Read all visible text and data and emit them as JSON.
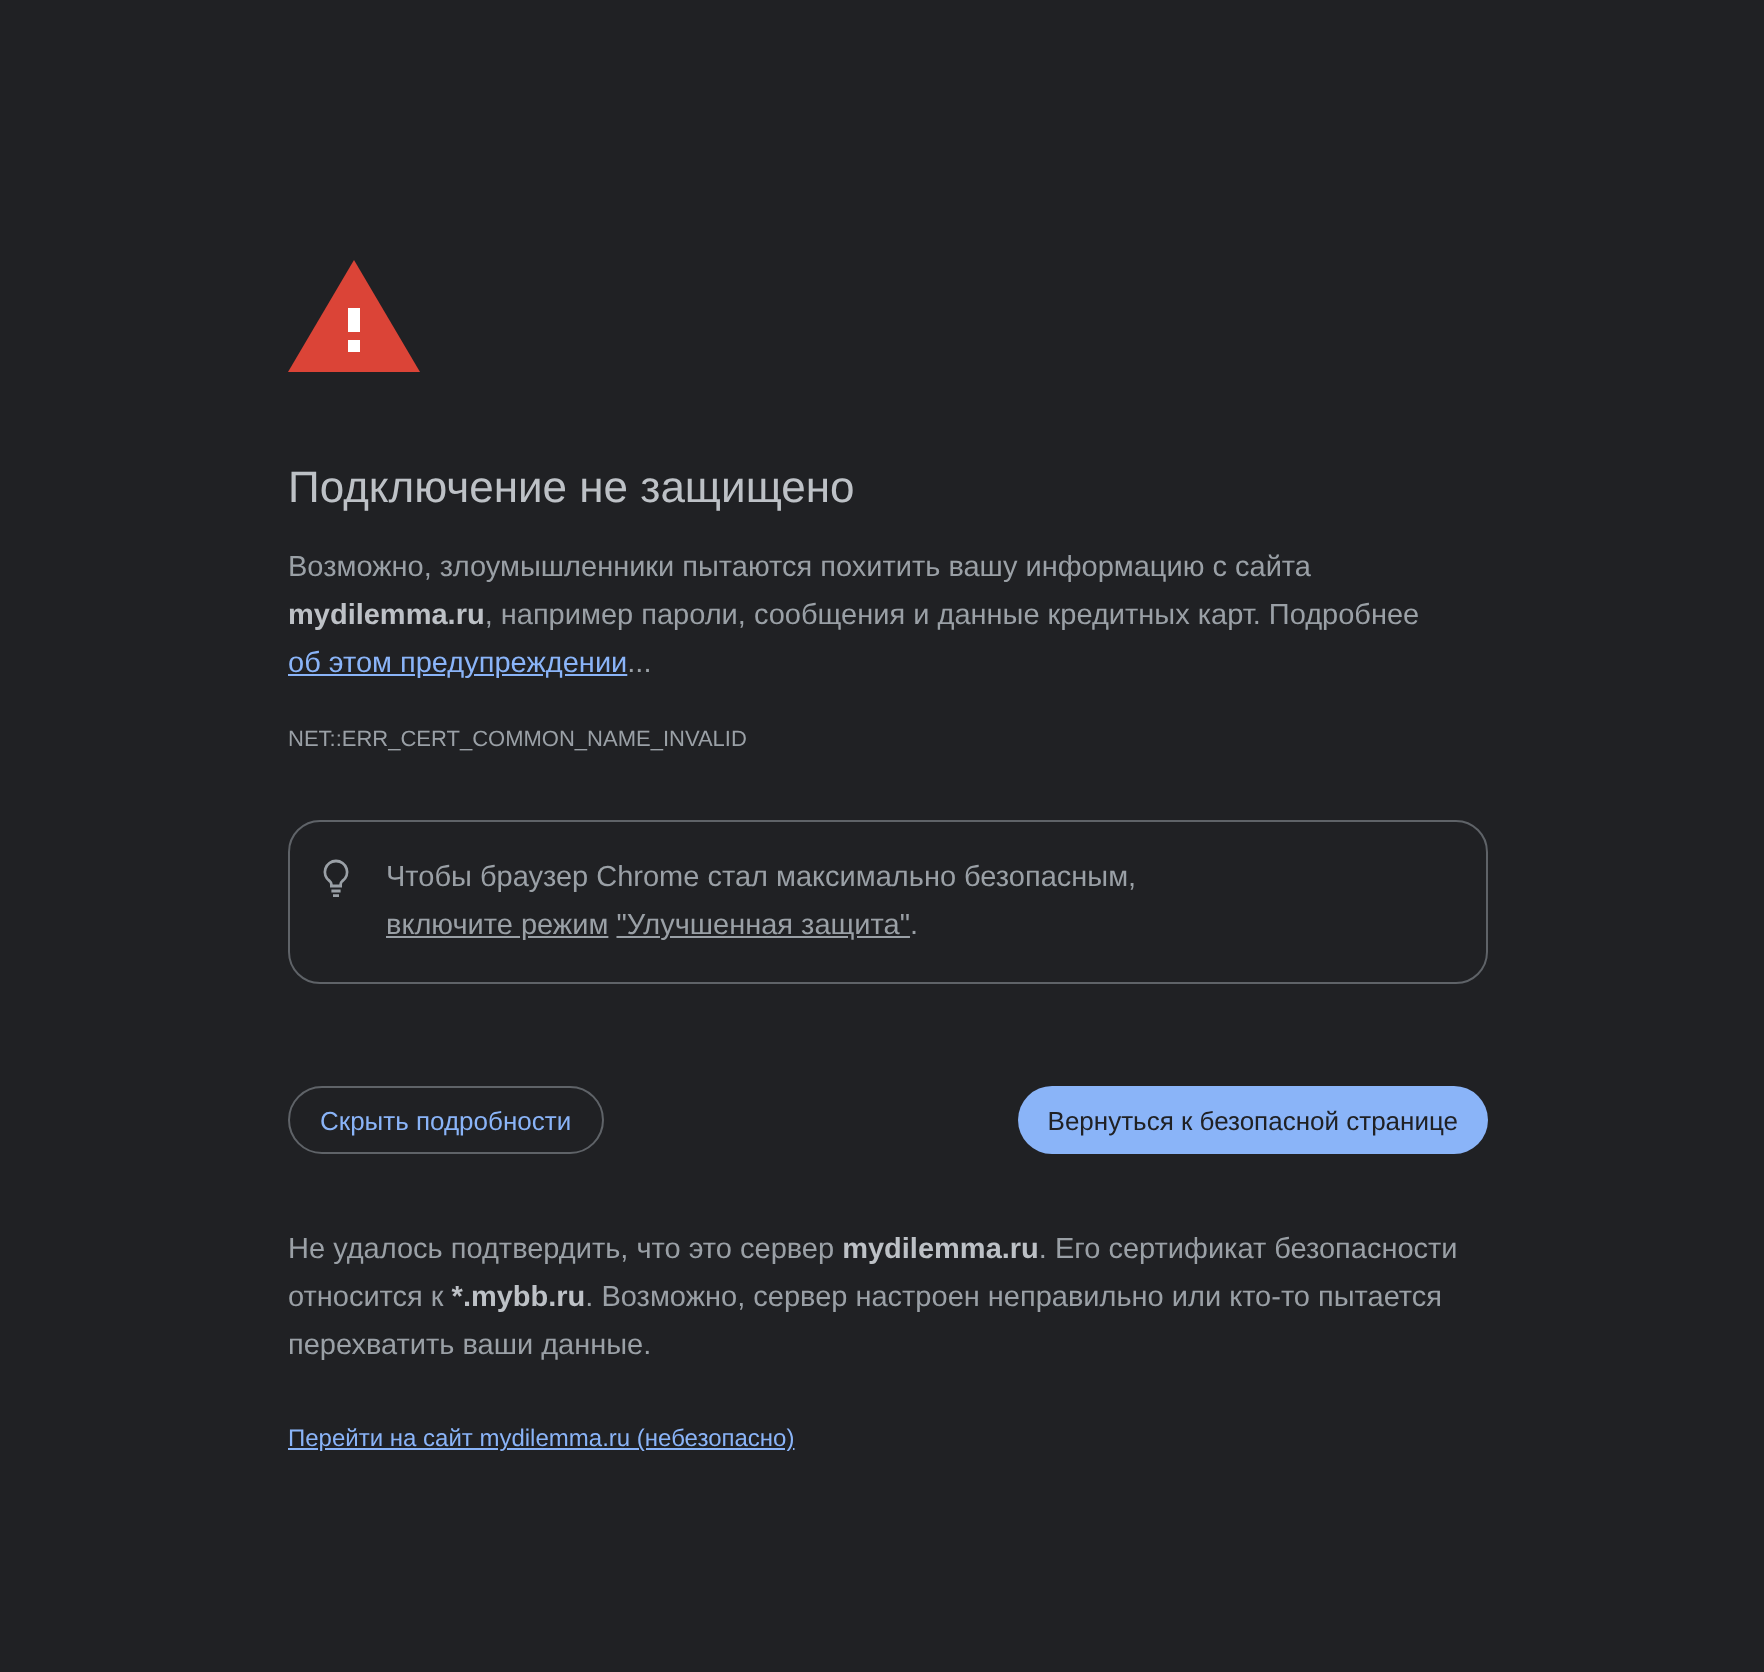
{
  "heading": "Подключение не защищено",
  "intro": [
    {
      "kind": "text",
      "text": "Возможно, злоумышленники пытаются похитить вашу информацию с сайта **mydilemma.ru**, например пароли, сообщения и данные кредитных карт. Подробнее "
    },
    {
      "kind": "link",
      "text": "об этом предупреждении"
    },
    {
      "kind": "text",
      "text": "..."
    }
  ],
  "error_code": "NET::ERR_CERT_COMMON_NAME_INVALID",
  "tip": [
    {
      "kind": "text",
      "text": "Чтобы браузер Chrome стал максимально безопасным, "
    },
    {
      "kind": "link",
      "text": "включите режим"
    },
    {
      "kind": "link",
      "text": "\"Улучшенная защита\""
    },
    {
      "kind": "text",
      "text": "."
    }
  ],
  "buttons": [
    {
      "label": "Скрыть подробности",
      "kind": "secondary"
    },
    {
      "label": "Вернуться к безопасной странице",
      "kind": "primary"
    }
  ],
  "details": [
    {
      "kind": "text",
      "text": "Не удалось подтвердить, что это сервер **mydilemma.ru**. Его сертификат безопасности относится к ***.mybb.ru**. Возможно, сервер настроен неправильно или кто-то пытается перехватить ваши данные."
    }
  ],
  "proceed_link": "Перейти на сайт mydilemma.ru (небезопасно)"
}
